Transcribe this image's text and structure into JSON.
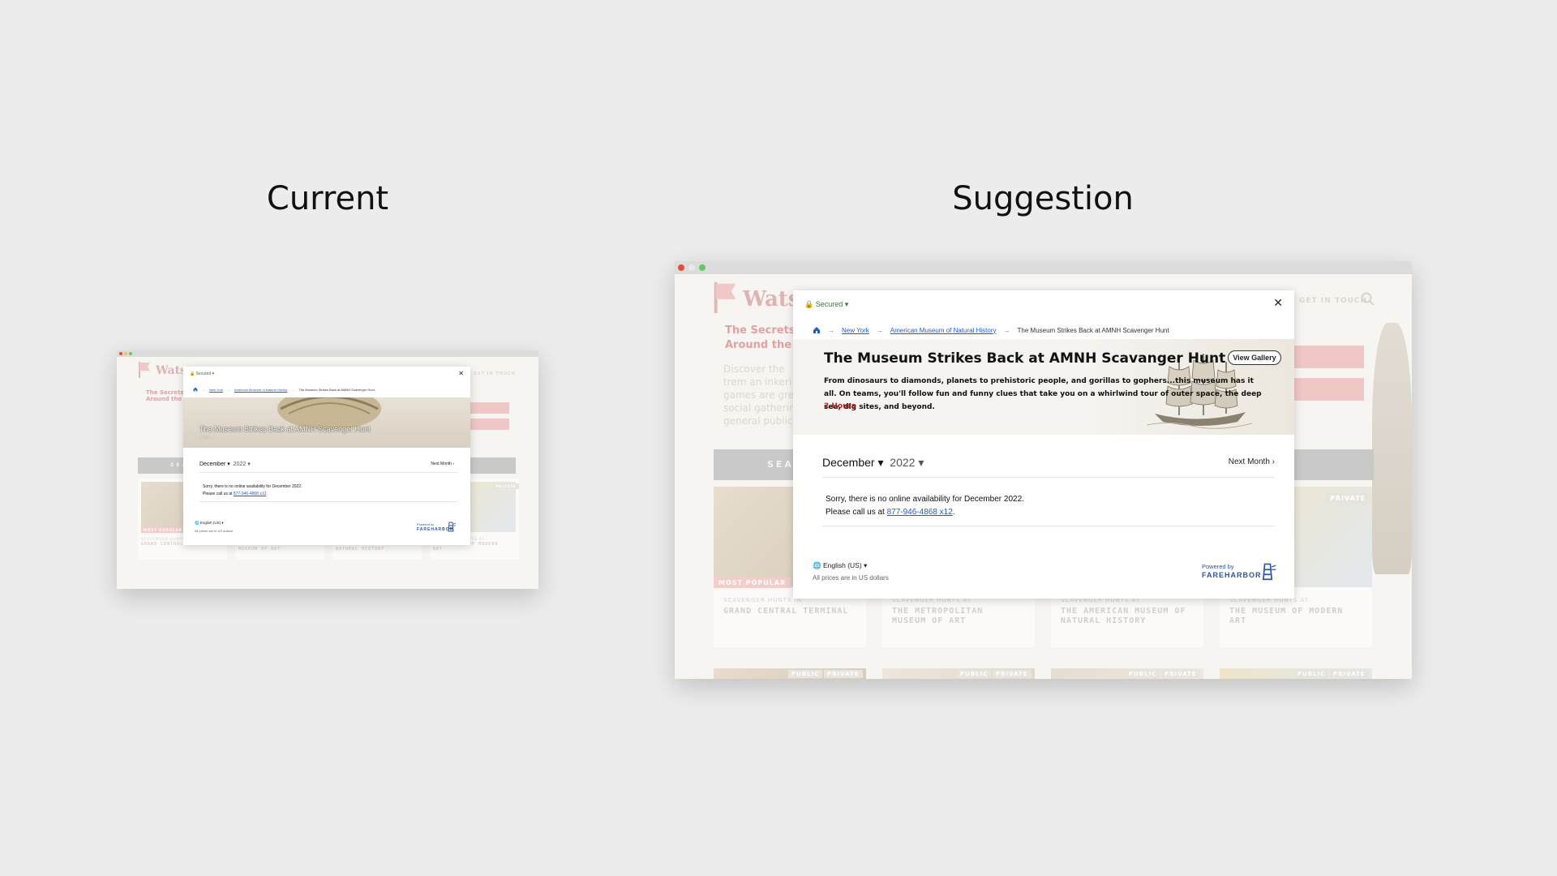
{
  "headings": {
    "current": "Current",
    "suggestion": "Suggestion"
  },
  "colors": {
    "secured_green": "#2e7d32",
    "link_blue": "#1f5bd1",
    "duration_red": "#b3261e",
    "fareharbor_blue": "#2d57a5",
    "chrome_red": "#e74c3c",
    "chrome_yellow": "#f4c542",
    "chrome_green": "#5ecb5e"
  },
  "site": {
    "logo": "Wats",
    "bullets": [
      "The Secrets",
      "Around the"
    ],
    "paragraph": [
      "Discover the",
      "trem an inkeri",
      "games are grea",
      "social gathering",
      "general public a"
    ],
    "nav": "GET IN TOUCH",
    "search_label": "SEA",
    "most_popular": "MOST POPULAR",
    "private": "PRIVATE",
    "public": "PUBLIC",
    "card_kicker": "SCAVENGER HUNTS AT",
    "card_kicker_first": "SCAVENGER HUNTS IN",
    "cards": [
      "GRAND CENTRAL TERMINAL",
      "THE METROPOLITAN MUSEUM OF ART",
      "THE AMERICAN MUSEUM OF NATURAL HISTORY",
      "THE MUSEUM OF MODERN ART"
    ]
  },
  "modal": {
    "secured": "Secured",
    "close_glyph": "✕",
    "breadcrumbs": [
      "New York",
      "American Museum of Natural History",
      "The Museum Strikes Back at AMNH Scavenger Hunt"
    ],
    "current_title": "The Museum Strikes Back at AMNH Scavenger Hunt",
    "current_subtitle": "2 Hours",
    "title": "The Museum Strikes Back at AMNH Scavanger Hunt",
    "view_gallery": "View Gallery",
    "description": "From dinosaurs to diamonds, planets to prehistoric people, and gorillas to gophers...this museum has it all. On teams, you'll follow fun and funny clues that take you on a whirlwind tour of outer space, the deep sea, dig sites, and beyond.",
    "duration": "2 Hours",
    "calendar": {
      "month": "December",
      "year": "2022",
      "next_month": "Next Month"
    },
    "availability": "Sorry, there is no online availability for December 2022.",
    "call_prefix": "Please call us at ",
    "phone": "877-946-4868 x12",
    "call_suffix": ".",
    "language": "English (US)",
    "prices_note": "All prices are in US dollars",
    "powered_by": "Powered by",
    "brand": "FAREHARBOR"
  }
}
